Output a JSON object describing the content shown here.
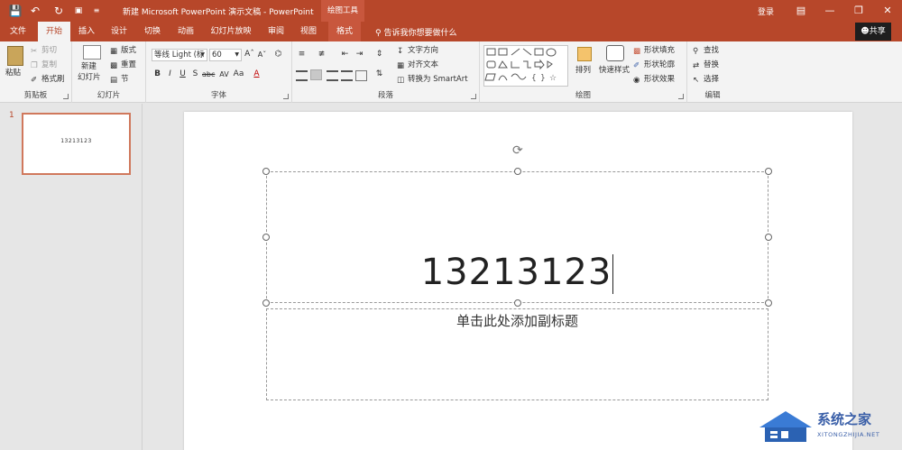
{
  "titlebar": {
    "doc_title": "新建 Microsoft PowerPoint 演示文稿 - PowerPoint",
    "contextual": "绘图工具",
    "login": "登录"
  },
  "tabs": [
    {
      "label": "文件"
    },
    {
      "label": "开始"
    },
    {
      "label": "插入"
    },
    {
      "label": "设计"
    },
    {
      "label": "切换"
    },
    {
      "label": "动画"
    },
    {
      "label": "幻灯片放映"
    },
    {
      "label": "审阅"
    },
    {
      "label": "视图"
    },
    {
      "label": "格式"
    }
  ],
  "tell_me": "告诉我你想要做什么",
  "share": "共享",
  "ribbon": {
    "clipboard": {
      "paste": "粘贴",
      "cut": "剪切",
      "copy": "复制",
      "painter": "格式刷",
      "label": "剪贴板"
    },
    "slides": {
      "new_slide_1": "新建",
      "new_slide_2": "幻灯片",
      "layout": "版式",
      "reset": "重置",
      "section": "节",
      "label": "幻灯片"
    },
    "font": {
      "name": "等线 Light (标",
      "size": "60",
      "label": "字体"
    },
    "paragraph": {
      "text_direction": "文字方向",
      "align_text": "对齐文本",
      "smartart": "转换为 SmartArt",
      "label": "段落"
    },
    "drawing": {
      "arrange": "排列",
      "quick_styles": "快速样式",
      "fill": "形状填充",
      "outline": "形状轮廓",
      "effects": "形状效果",
      "label": "绘图"
    },
    "editing": {
      "find": "查找",
      "replace": "替换",
      "select": "选择",
      "label": "编辑"
    }
  },
  "slide_panel": {
    "number": "1",
    "thumb_text": "13213123"
  },
  "slide": {
    "title": "13213123",
    "subtitle_placeholder": "单击此处添加副标题"
  },
  "watermark": {
    "main": "系统之家",
    "sub": "XITONGZHIJIA.NET"
  },
  "colors": {
    "accent": "#b7472a",
    "thumb_border": "#d0785c"
  }
}
